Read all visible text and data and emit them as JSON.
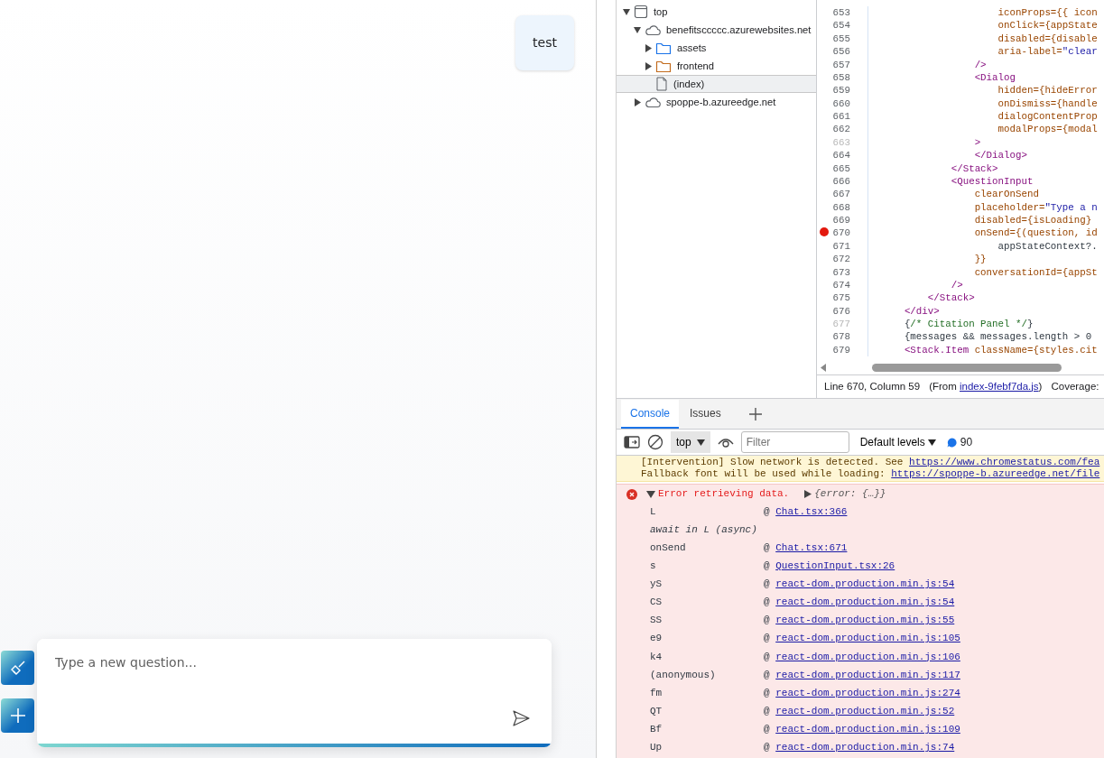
{
  "chat": {
    "messages": [
      {
        "text": "test"
      }
    ],
    "input": {
      "placeholder": "Type a new question..."
    }
  },
  "devtools": {
    "tree": [
      {
        "label": "top",
        "kind": "frame",
        "expanded": true,
        "selected": false,
        "children": [
          {
            "label": "benefitsccccc.azurewebsites.net",
            "kind": "domain",
            "expanded": true,
            "selected": false,
            "children": [
              {
                "label": "assets",
                "kind": "folder",
                "color": "#1a73e8",
                "expanded": false,
                "selected": false
              },
              {
                "label": "frontend",
                "kind": "folder",
                "color": "#c26b1d",
                "expanded": false,
                "selected": false
              },
              {
                "label": "(index)",
                "kind": "file",
                "selected": true
              }
            ]
          },
          {
            "label": "spoppe-b.azureedge.net",
            "kind": "domain",
            "expanded": false,
            "selected": false
          }
        ]
      }
    ],
    "code": [
      {
        "number": "653",
        "dimmed": false,
        "breakpoint": false,
        "parts": [
          {
            "kind": "attr",
            "t": "                      iconProps={{ icon"
          }
        ]
      },
      {
        "number": "654",
        "dimmed": false,
        "breakpoint": false,
        "parts": [
          {
            "kind": "attr",
            "t": "                      onClick={appState"
          }
        ]
      },
      {
        "number": "655",
        "dimmed": false,
        "breakpoint": false,
        "parts": [
          {
            "kind": "attr",
            "t": "                      disabled={disable"
          }
        ]
      },
      {
        "number": "656",
        "dimmed": false,
        "breakpoint": false,
        "parts": [
          {
            "kind": "attr",
            "t": "                      aria-label="
          },
          {
            "kind": "string",
            "t": "\"clear"
          }
        ]
      },
      {
        "number": "657",
        "dimmed": false,
        "breakpoint": false,
        "parts": [
          {
            "kind": "tag",
            "t": "                  />"
          }
        ]
      },
      {
        "number": "658",
        "dimmed": false,
        "breakpoint": false,
        "parts": [
          {
            "kind": "tag",
            "t": "                  <Dialog"
          }
        ]
      },
      {
        "number": "659",
        "dimmed": false,
        "breakpoint": false,
        "parts": [
          {
            "kind": "attr",
            "t": "                      hidden={hideError"
          }
        ]
      },
      {
        "number": "660",
        "dimmed": false,
        "breakpoint": false,
        "parts": [
          {
            "kind": "attr",
            "t": "                      onDismiss={handle"
          }
        ]
      },
      {
        "number": "661",
        "dimmed": false,
        "breakpoint": false,
        "parts": [
          {
            "kind": "attr",
            "t": "                      dialogContentProp"
          }
        ]
      },
      {
        "number": "662",
        "dimmed": false,
        "breakpoint": false,
        "parts": [
          {
            "kind": "attr",
            "t": "                      modalProps={modal"
          }
        ]
      },
      {
        "number": "663",
        "dimmed": true,
        "breakpoint": false,
        "parts": [
          {
            "kind": "tag",
            "t": "                  >"
          }
        ]
      },
      {
        "number": "664",
        "dimmed": false,
        "breakpoint": false,
        "parts": [
          {
            "kind": "tag",
            "t": "                  </Dialog>"
          }
        ]
      },
      {
        "number": "665",
        "dimmed": false,
        "breakpoint": false,
        "parts": [
          {
            "kind": "tag",
            "t": "              </Stack>"
          }
        ]
      },
      {
        "number": "666",
        "dimmed": false,
        "breakpoint": false,
        "parts": [
          {
            "kind": "tag",
            "t": "              <QuestionInput"
          }
        ]
      },
      {
        "number": "667",
        "dimmed": false,
        "breakpoint": false,
        "parts": [
          {
            "kind": "attr",
            "t": "                  clearOnSend"
          }
        ]
      },
      {
        "number": "668",
        "dimmed": false,
        "breakpoint": false,
        "parts": [
          {
            "kind": "attr",
            "t": "                  placeholder="
          },
          {
            "kind": "string",
            "t": "\"Type a n"
          }
        ]
      },
      {
        "number": "669",
        "dimmed": false,
        "breakpoint": false,
        "parts": [
          {
            "kind": "attr",
            "t": "                  disabled={isLoading}"
          }
        ]
      },
      {
        "number": "670",
        "dimmed": false,
        "breakpoint": true,
        "parts": [
          {
            "kind": "attr",
            "t": "                  onSend={(question, id"
          }
        ]
      },
      {
        "number": "671",
        "dimmed": false,
        "breakpoint": false,
        "parts": [
          {
            "kind": "plain",
            "t": "                      appStateContext?."
          }
        ]
      },
      {
        "number": "672",
        "dimmed": false,
        "breakpoint": false,
        "parts": [
          {
            "kind": "attr",
            "t": "                  }}"
          }
        ]
      },
      {
        "number": "673",
        "dimmed": false,
        "breakpoint": false,
        "parts": [
          {
            "kind": "attr",
            "t": "                  conversationId={appSt"
          }
        ]
      },
      {
        "number": "674",
        "dimmed": false,
        "breakpoint": false,
        "parts": [
          {
            "kind": "tag",
            "t": "              />"
          }
        ]
      },
      {
        "number": "675",
        "dimmed": false,
        "breakpoint": false,
        "parts": [
          {
            "kind": "tag",
            "t": "          </Stack>"
          }
        ]
      },
      {
        "number": "676",
        "dimmed": false,
        "breakpoint": false,
        "parts": [
          {
            "kind": "tag",
            "t": "      </div>"
          }
        ]
      },
      {
        "number": "677",
        "dimmed": true,
        "breakpoint": false,
        "parts": [
          {
            "kind": "plain",
            "t": "      {"
          },
          {
            "kind": "comment",
            "t": "/* Citation Panel */"
          },
          {
            "kind": "plain",
            "t": "}"
          }
        ]
      },
      {
        "number": "678",
        "dimmed": false,
        "breakpoint": false,
        "parts": [
          {
            "kind": "plain",
            "t": "      {messages && messages.length > 0"
          }
        ]
      },
      {
        "number": "679",
        "dimmed": false,
        "breakpoint": false,
        "parts": [
          {
            "kind": "tag",
            "t": "      <Stack.Item "
          },
          {
            "kind": "attr",
            "t": "className={styles.cit"
          }
        ]
      }
    ],
    "status": {
      "position": "Line 670, Column 59",
      "from_prefix": "(From",
      "from_link": "index-9febf7da.js",
      "from_suffix": ")",
      "coverage": "Coverage:"
    },
    "tabs": [
      {
        "label": "Console",
        "selected": true
      },
      {
        "label": "Issues",
        "selected": false
      }
    ],
    "toolbar": {
      "context": "top",
      "filter_placeholder": "Filter",
      "levels": "Default levels",
      "message_count": "90"
    },
    "messages": [
      {
        "kind": "warning",
        "lines": [
          {
            "text": "[Intervention] Slow network is detected. See ",
            "link": "https://www.chromestatus.com/fea"
          },
          {
            "text": "Fallback font will be used while loading: ",
            "link": "https://spoppe-b.azureedge.net/file"
          }
        ]
      },
      {
        "kind": "error",
        "expanded": true,
        "text": "Error retrieving data.",
        "object": "{error: {…}}",
        "frames": [
          {
            "kind": "frame",
            "fn": "L",
            "at": "@",
            "link": "Chat.tsx:366"
          },
          {
            "kind": "async",
            "fn": "await in L (async)"
          },
          {
            "kind": "frame",
            "fn": "onSend",
            "at": "@",
            "link": "Chat.tsx:671"
          },
          {
            "kind": "frame",
            "fn": "s",
            "at": "@",
            "link": "QuestionInput.tsx:26"
          },
          {
            "kind": "frame",
            "fn": "yS",
            "at": "@",
            "link": "react-dom.production.min.js:54"
          },
          {
            "kind": "frame",
            "fn": "CS",
            "at": "@",
            "link": "react-dom.production.min.js:54"
          },
          {
            "kind": "frame",
            "fn": "SS",
            "at": "@",
            "link": "react-dom.production.min.js:55"
          },
          {
            "kind": "frame",
            "fn": "e9",
            "at": "@",
            "link": "react-dom.production.min.js:105"
          },
          {
            "kind": "frame",
            "fn": "k4",
            "at": "@",
            "link": "react-dom.production.min.js:106"
          },
          {
            "kind": "frame",
            "fn": "(anonymous)",
            "at": "@",
            "link": "react-dom.production.min.js:117"
          },
          {
            "kind": "frame",
            "fn": "fm",
            "at": "@",
            "link": "react-dom.production.min.js:274"
          },
          {
            "kind": "frame",
            "fn": "QT",
            "at": "@",
            "link": "react-dom.production.min.js:52"
          },
          {
            "kind": "frame",
            "fn": "Bf",
            "at": "@",
            "link": "react-dom.production.min.js:109"
          },
          {
            "kind": "frame",
            "fn": "Up",
            "at": "@",
            "link": "react-dom.production.min.js:74"
          }
        ]
      }
    ]
  }
}
